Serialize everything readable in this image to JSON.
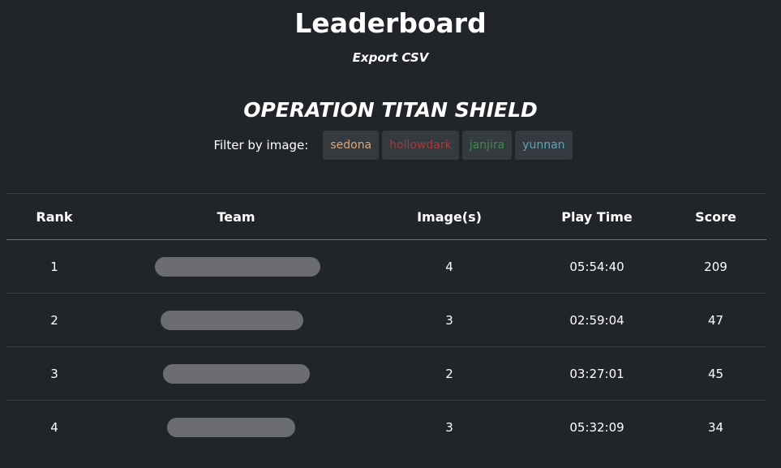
{
  "page": {
    "title": "Leaderboard",
    "export_label": "Export CSV",
    "operation_title": "OPERATION TITAN SHIELD"
  },
  "filter": {
    "label": "Filter by image:",
    "images": [
      {
        "label": "sedona",
        "color": "#d9a77a"
      },
      {
        "label": "hollowdark",
        "color": "#a23a3a"
      },
      {
        "label": "janjira",
        "color": "#3f8a4a"
      },
      {
        "label": "yunnan",
        "color": "#5ba6b8"
      }
    ]
  },
  "table": {
    "columns": [
      "Rank",
      "Team",
      "Image(s)",
      "Play Time",
      "Score"
    ],
    "rows": [
      {
        "rank": "1",
        "team": "",
        "images": "4",
        "play_time": "05:54:40",
        "score": "209"
      },
      {
        "rank": "2",
        "team": "",
        "images": "3",
        "play_time": "02:59:04",
        "score": "47"
      },
      {
        "rank": "3",
        "team": "",
        "images": "2",
        "play_time": "03:27:01",
        "score": "45"
      },
      {
        "rank": "4",
        "team": "",
        "images": "3",
        "play_time": "05:32:09",
        "score": "34"
      }
    ]
  },
  "colors": {
    "background": "#212529",
    "button_background": "#343a40",
    "redaction": "#6b6d70"
  }
}
